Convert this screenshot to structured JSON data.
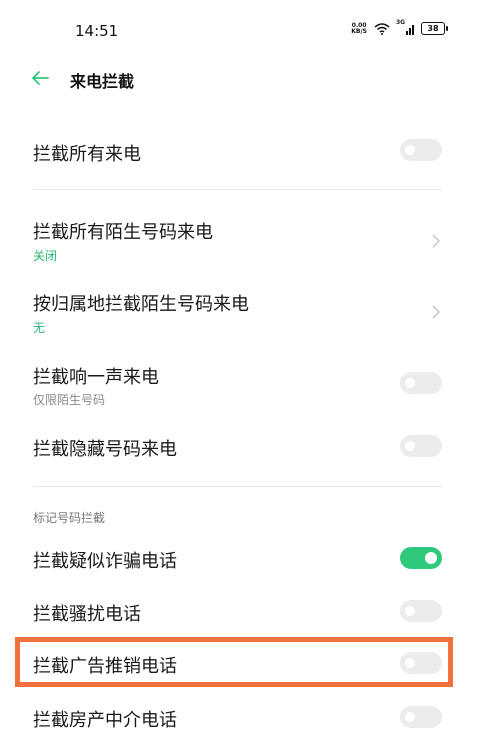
{
  "status_bar": {
    "time": "14:51",
    "net_speed_top": "0.00",
    "net_speed_bottom": "KB/S",
    "network_type": "3G",
    "battery": "38"
  },
  "header": {
    "title": "来电拦截",
    "back_icon": "arrow-left-icon"
  },
  "items": [
    {
      "title": "拦截所有来电",
      "subtitle": "",
      "control": "toggle",
      "on": false
    },
    {
      "title": "拦截所有陌生号码来电",
      "subtitle": "关闭",
      "control": "chevron"
    },
    {
      "title": "按归属地拦截陌生号码来电",
      "subtitle": "无",
      "control": "chevron"
    },
    {
      "title": "拦截响一声来电",
      "subtitle": "仅限陌生号码",
      "control": "toggle",
      "on": false
    },
    {
      "title": "拦截隐藏号码来电",
      "subtitle": "",
      "control": "toggle",
      "on": false
    }
  ],
  "section": {
    "label": "标记号码拦截",
    "items": [
      {
        "title": "拦截疑似诈骗电话",
        "control": "toggle",
        "on": true
      },
      {
        "title": "拦截骚扰电话",
        "control": "toggle",
        "on": false
      },
      {
        "title": "拦截广告推销电话",
        "control": "toggle",
        "on": false,
        "highlighted": true
      },
      {
        "title": "拦截房产中介电话",
        "control": "toggle",
        "on": false
      }
    ]
  },
  "colors": {
    "accent": "#2ec97a",
    "subtitle_green": "#2bb673",
    "highlight": "#f07040"
  }
}
